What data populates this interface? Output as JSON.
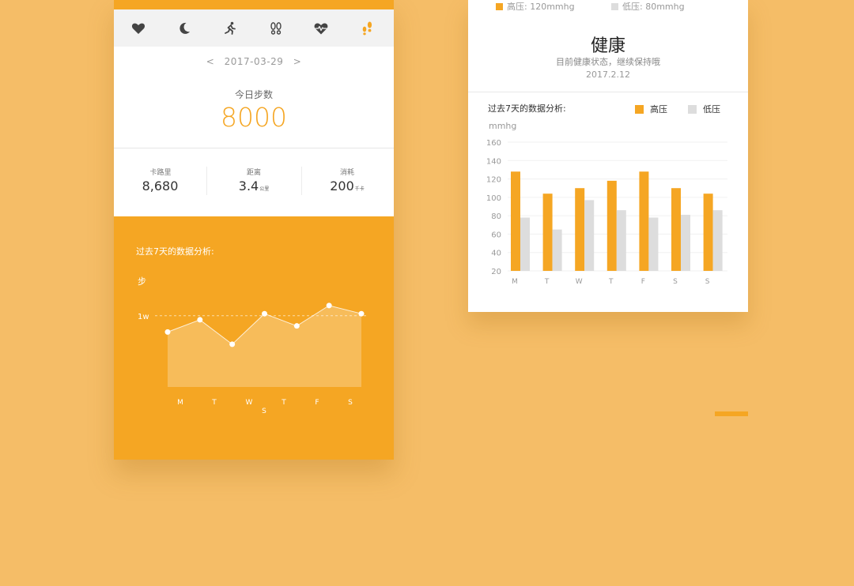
{
  "colors": {
    "accent": "#F5A623",
    "background": "#F5BD67",
    "low": "#DDDDDD"
  },
  "icon_bar": {
    "icons": [
      "heart-icon",
      "moon-icon",
      "running-icon",
      "footprints-icon",
      "heart-rate-icon",
      "footprints-active-icon"
    ]
  },
  "date_nav": {
    "prev": "<",
    "date": "2017-03-29",
    "next": ">"
  },
  "steps": {
    "label": "今日步数",
    "value": "8000"
  },
  "stats": [
    {
      "label": "卡路里",
      "value": "8,680",
      "unit": ""
    },
    {
      "label": "距离",
      "value": "3.4",
      "unit": "公里"
    },
    {
      "label": "消耗",
      "value": "200",
      "unit": "千卡"
    }
  ],
  "step_chart": {
    "title": "过去7天的数据分析:",
    "unit": "步",
    "ref_label": "1w"
  },
  "bp_card": {
    "legend_top": [
      {
        "label": "高压: 120mmhg"
      },
      {
        "label": "低压: 80mmhg"
      }
    ],
    "status_title": "健康",
    "status_sub": "目前健康状态，继续保持哦",
    "status_date": "2017.2.12",
    "chart_title": "过去7天的数据分析:",
    "legend": [
      {
        "label": "高压"
      },
      {
        "label": "低压"
      }
    ],
    "unit": "mmhg"
  },
  "chart_data": [
    {
      "type": "area",
      "title": "过去7天的数据分析:",
      "ylabel": "步",
      "categories": [
        "M",
        "T",
        "W",
        "T",
        "F",
        "S",
        "S"
      ],
      "x_tick_labels": [
        "M",
        "T",
        "W",
        "T",
        "F",
        "S",
        "S"
      ],
      "reference_line": {
        "label": "1w",
        "value": 10000
      },
      "series": [
        {
          "values": [
            9200,
            9800,
            8600,
            10100,
            9500,
            10500,
            10100
          ]
        }
      ],
      "ylim": [
        6500,
        11000
      ],
      "grid": false
    },
    {
      "type": "bar",
      "title": "过去7天的数据分析:",
      "ylabel": "mmhg",
      "categories": [
        "M",
        "T",
        "W",
        "T",
        "F",
        "S",
        "S"
      ],
      "ylim": [
        20,
        160
      ],
      "yticks": [
        20,
        40,
        60,
        80,
        100,
        120,
        140,
        160
      ],
      "grid": true,
      "legend_position": "top-right",
      "series": [
        {
          "name": "高压",
          "color": "#F5A623",
          "values": [
            128,
            104,
            110,
            118,
            128,
            110,
            104
          ]
        },
        {
          "name": "低压",
          "color": "#DDDDDD",
          "values": [
            78,
            65,
            97,
            86,
            78,
            81,
            86
          ]
        }
      ]
    }
  ]
}
